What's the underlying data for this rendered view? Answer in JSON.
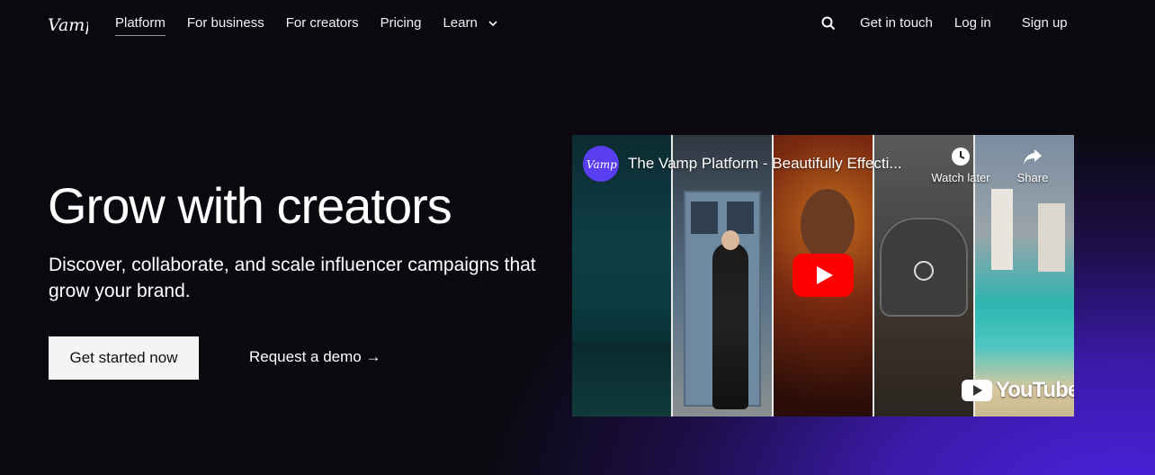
{
  "brand": {
    "logo_text": "Vamp"
  },
  "nav": {
    "items": [
      {
        "label": "Platform",
        "active": true
      },
      {
        "label": "For business"
      },
      {
        "label": "For creators"
      },
      {
        "label": "Pricing"
      },
      {
        "label": "Learn",
        "dropdown": true
      }
    ]
  },
  "header_actions": {
    "get_in_touch": "Get in touch",
    "log_in": "Log in",
    "sign_up": "Sign up"
  },
  "hero": {
    "title": "Grow with creators",
    "subtitle": "Discover, collaborate, and scale influencer campaigns that grow your brand.",
    "primary_cta": "Get started now",
    "secondary_cta": "Request a demo →"
  },
  "video": {
    "channel_avatar_text": "Vamp",
    "title": "The Vamp Platform - Beautifully Effecti...",
    "watch_later": "Watch later",
    "share": "Share",
    "provider": "YouTube"
  },
  "colors": {
    "background": "#0b090f",
    "accent_gradient": "#4a22e0",
    "youtube_red": "#ff0000",
    "button_bg": "#f4f4f4"
  },
  "icons": [
    "search-icon",
    "chevron-down-icon",
    "clock-icon",
    "share-icon",
    "play-icon",
    "youtube-icon"
  ]
}
